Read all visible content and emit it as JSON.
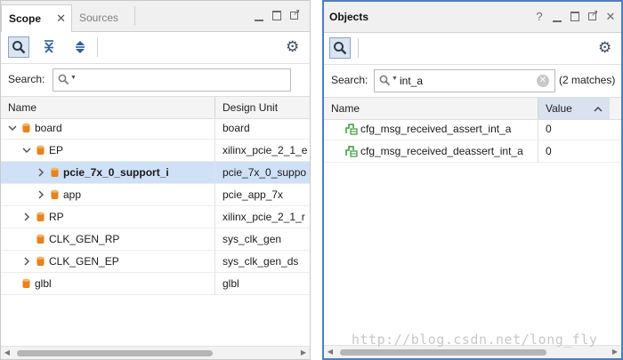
{
  "scope_panel": {
    "tabs": [
      {
        "label": "Scope",
        "active": true
      },
      {
        "label": "Sources",
        "active": false
      }
    ],
    "tab_close": "✕",
    "search_label": "Search:",
    "search_value": "",
    "columns": [
      "Name",
      "Design Unit"
    ],
    "rows": [
      {
        "name": "board",
        "unit": "board",
        "expander": "expanded",
        "selected": false
      },
      {
        "name": "EP",
        "unit": "xilinx_pcie_2_1_e",
        "expander": "expanded",
        "selected": false
      },
      {
        "name": "pcie_7x_0_support_i",
        "unit": "pcie_7x_0_suppo",
        "expander": "collapsed",
        "selected": true
      },
      {
        "name": "app",
        "unit": "pcie_app_7x",
        "expander": "collapsed",
        "selected": false
      },
      {
        "name": "RP",
        "unit": "xilinx_pcie_2_1_r",
        "expander": "collapsed",
        "selected": false
      },
      {
        "name": "CLK_GEN_RP",
        "unit": "sys_clk_gen",
        "expander": "none",
        "selected": false
      },
      {
        "name": "CLK_GEN_EP",
        "unit": "sys_clk_gen_ds",
        "expander": "collapsed",
        "selected": false
      },
      {
        "name": "glbl",
        "unit": "glbl",
        "expander": "none",
        "selected": false
      }
    ]
  },
  "objects_panel": {
    "title": "Objects",
    "help": "?",
    "search_label": "Search:",
    "search_value": "int_a",
    "match_count": "(2 matches)",
    "columns": [
      "Name",
      "Value"
    ],
    "rows": [
      {
        "name": "cfg_msg_received_assert_int_a",
        "value": "0"
      },
      {
        "name": "cfg_msg_received_deassert_int_a",
        "value": "0"
      }
    ]
  },
  "watermark": "http://blog.csdn.net/long_fly",
  "colors": {
    "accent_border": "#4b7fc2",
    "selection": "#cfe1f7",
    "module_icon": "#e8821e",
    "signal_icon": "#3a9a3a"
  },
  "icons": [
    "search-icon",
    "collapse-all-icon",
    "expand-all-icon",
    "gear-icon",
    "minimize-icon",
    "maximize-icon",
    "float-icon",
    "close-icon",
    "help-icon",
    "module-icon",
    "signal-icon",
    "chevron-icon",
    "sort-up-icon"
  ]
}
